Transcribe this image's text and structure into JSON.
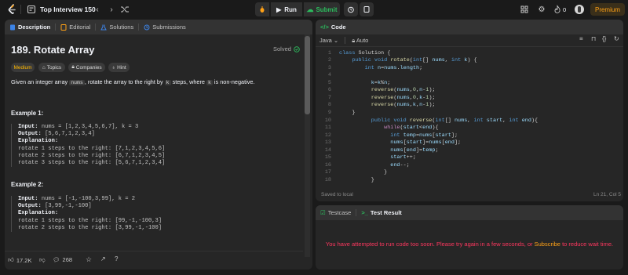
{
  "topbar": {
    "title": "Top Interview 150",
    "run_label": "Run",
    "submit_label": "Submit",
    "streak_count": "0",
    "premium_label": "Premium"
  },
  "left_tabs": [
    "Description",
    "Editorial",
    "Solutions",
    "Submissions"
  ],
  "problem": {
    "title": "189. Rotate Array",
    "status": "Solved",
    "difficulty": "Medium",
    "chips": [
      "Topics",
      "Companies",
      "Hint"
    ],
    "statement_parts": [
      "Given an integer array ",
      "nums",
      ", rotate the array to the right by ",
      "k",
      " steps, where ",
      "k",
      " is non-negative."
    ],
    "examples": [
      {
        "heading": "Example 1:",
        "input_label": "Input:",
        "input": "nums = [1,2,3,4,5,6,7], k = 3",
        "output_label": "Output:",
        "output": "[5,6,7,1,2,3,4]",
        "explanation_label": "Explanation:",
        "explanation": [
          "rotate 1 steps to the right: [7,1,2,3,4,5,6]",
          "rotate 2 steps to the right: [6,7,1,2,3,4,5]",
          "rotate 3 steps to the right: [5,6,7,1,2,3,4]"
        ]
      },
      {
        "heading": "Example 2:",
        "input_label": "Input:",
        "input": "nums = [-1,-100,3,99], k = 2",
        "output_label": "Output:",
        "output": "[3,99,-1,-100]",
        "explanation_label": "Explanation:",
        "explanation": [
          "rotate 1 steps to the right: [99,-1,-100,3]",
          "rotate 2 steps to the right: [3,99,-1,-100]"
        ]
      }
    ]
  },
  "footer": {
    "likes": "17.2K",
    "comments": "268"
  },
  "code_panel": {
    "title": "Code",
    "language": "Java",
    "mode": "Auto",
    "saved": "Saved to local",
    "cursor": "Ln 21, Col 5",
    "line_numbers": [
      "1",
      "2",
      "3",
      "4",
      "5",
      "6",
      "7",
      "8",
      "9",
      "10",
      "11",
      "12",
      "13",
      "14",
      "15",
      "16",
      "17",
      "18"
    ]
  },
  "result_panel": {
    "tabs": [
      "Testcase",
      "Test Result"
    ],
    "message_pre": "You have attempted to run code too soon. Please try again in a few seconds, or ",
    "message_link": "Subscribe",
    "message_post": " to reduce wait time."
  }
}
